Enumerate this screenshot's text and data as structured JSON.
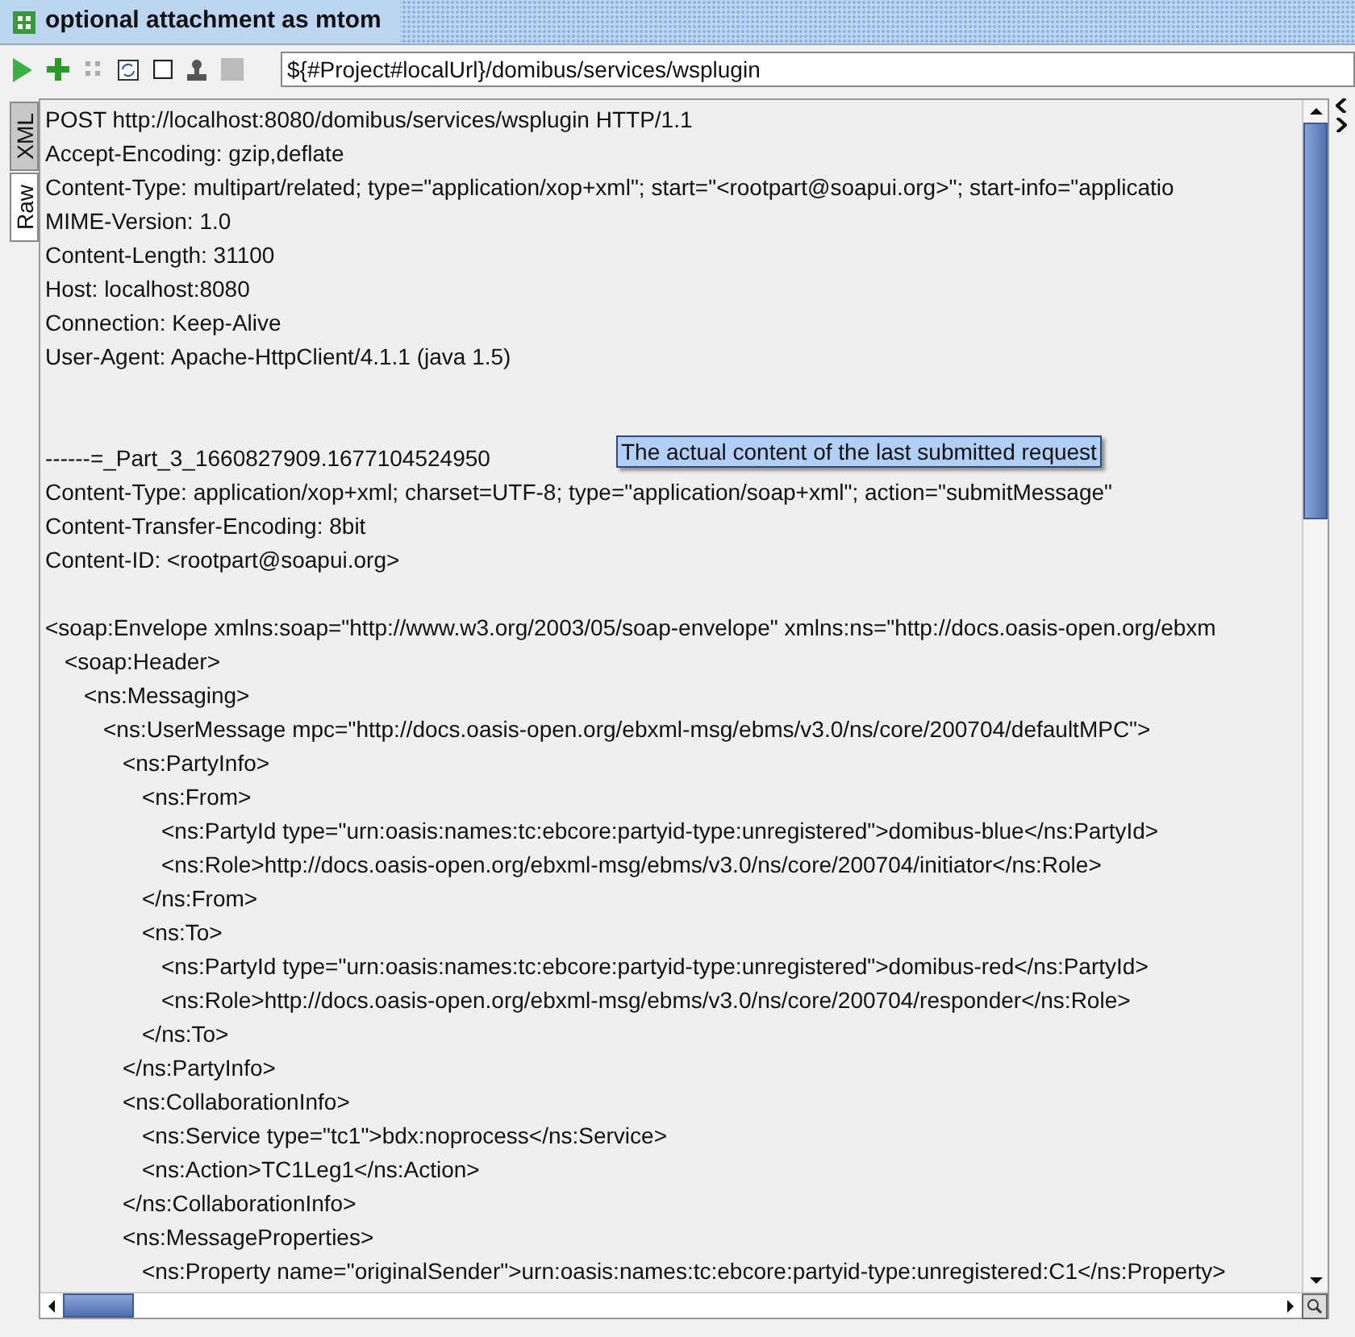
{
  "window": {
    "title": "optional attachment as mtom"
  },
  "toolbar": {
    "endpoint": "${#Project#localUrl}/domibus/services/wsplugin"
  },
  "side_tabs": [
    {
      "label": "XML",
      "selected": false
    },
    {
      "label": "Raw",
      "selected": true
    }
  ],
  "headers": [
    "POST http://localhost:8080/domibus/services/wsplugin HTTP/1.1",
    "Accept-Encoding: gzip,deflate",
    "Content-Type: multipart/related; type=\"application/xop+xml\"; start=\"<rootpart@soapui.org>\"; start-info=\"applicatio",
    "MIME-Version: 1.0",
    "Content-Length: 31100",
    "Host: localhost:8080",
    "Connection: Keep-Alive",
    "User-Agent: Apache-HttpClient/4.1.1 (java 1.5)"
  ],
  "part_headers": [
    "------=_Part_3_1660827909.1677104524950",
    "Content-Type: application/xop+xml; charset=UTF-8; type=\"application/soap+xml\"; action=\"submitMessage\"",
    "Content-Transfer-Encoding: 8bit",
    "Content-ID: <rootpart@soapui.org>"
  ],
  "xml": [
    {
      "text": "<soap:Envelope xmlns:soap=\"http://www.w3.org/2003/05/soap-envelope\" xmlns:ns=\"http://docs.oasis-open.org/ebxm",
      "children": [
        {
          "text": "<soap:Header>",
          "children": [
            {
              "text": "<ns:Messaging>",
              "children": [
                {
                  "text": "<ns:UserMessage mpc=\"http://docs.oasis-open.org/ebxml-msg/ebms/v3.0/ns/core/200704/defaultMPC\">",
                  "children": [
                    {
                      "text": "<ns:PartyInfo>",
                      "end": "</ns:PartyInfo>",
                      "children": [
                        {
                          "text": "<ns:From>",
                          "end": "</ns:From>",
                          "children": [
                            {
                              "text": "<ns:PartyId type=\"urn:oasis:names:tc:ebcore:partyid-type:unregistered\">domibus-blue</ns:PartyId>"
                            },
                            {
                              "text": "<ns:Role>http://docs.oasis-open.org/ebxml-msg/ebms/v3.0/ns/core/200704/initiator</ns:Role>"
                            }
                          ]
                        },
                        {
                          "text": "<ns:To>",
                          "end": "</ns:To>",
                          "children": [
                            {
                              "text": "<ns:PartyId type=\"urn:oasis:names:tc:ebcore:partyid-type:unregistered\">domibus-red</ns:PartyId>"
                            },
                            {
                              "text": "<ns:Role>http://docs.oasis-open.org/ebxml-msg/ebms/v3.0/ns/core/200704/responder</ns:Role>"
                            }
                          ]
                        }
                      ]
                    },
                    {
                      "text": "<ns:CollaborationInfo>",
                      "end": "</ns:CollaborationInfo>",
                      "children": [
                        {
                          "text": "<ns:Service type=\"tc1\">bdx:noprocess</ns:Service>"
                        },
                        {
                          "text": "<ns:Action>TC1Leg1</ns:Action>"
                        }
                      ]
                    },
                    {
                      "text": "<ns:MessageProperties>",
                      "children": [
                        {
                          "text": "<ns:Property name=\"originalSender\">urn:oasis:names:tc:ebcore:partyid-type:unregistered:C1</ns:Property>"
                        }
                      ]
                    }
                  ]
                }
              ]
            }
          ]
        }
      ]
    }
  ],
  "tooltip": "The actual content of the last submitted request"
}
